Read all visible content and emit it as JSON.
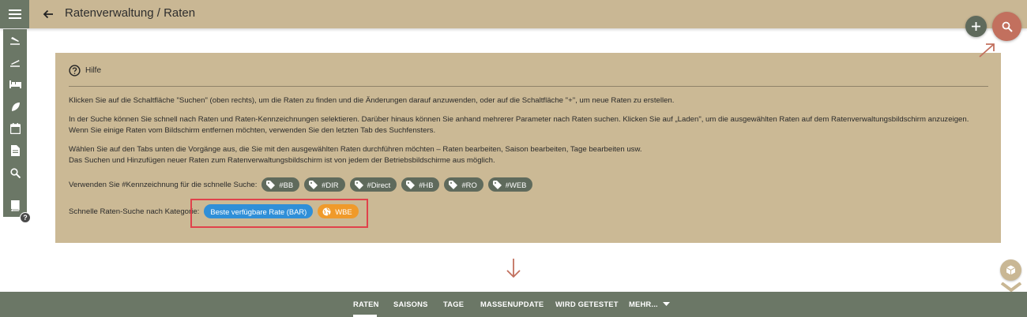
{
  "header": {
    "title": "Ratenverwaltung / Raten",
    "menu_icon": "menu-icon",
    "back_icon": "arrow-back-icon",
    "add_icon": "plus-icon",
    "search_icon": "search-icon"
  },
  "sidebar": {
    "items": [
      {
        "icon": "flight-land-icon"
      },
      {
        "icon": "flight-takeoff-icon"
      },
      {
        "icon": "bed-icon"
      },
      {
        "icon": "leaf-icon"
      },
      {
        "icon": "calendar-icon"
      },
      {
        "icon": "document-icon"
      },
      {
        "icon": "search-icon"
      },
      {
        "icon": "book-icon"
      }
    ],
    "help_badge": "?"
  },
  "panel": {
    "help_label": "Hilfe",
    "para1": "Klicken Sie auf die Schaltfläche \"Suchen\" (oben rechts), um die Raten zu finden und die Änderungen darauf anzuwenden, oder auf die Schaltfläche \"+\", um neue Raten zu erstellen.",
    "para2_line1": "In der Suche können Sie schnell nach Raten und Raten-Kennzeichnungen selektieren. Darüber hinaus können Sie anhand mehrerer Parameter nach Raten suchen. Klicken Sie auf „Laden\", um die ausgewählten Raten auf dem Ratenverwaltungsbildschirm anzuzeigen.",
    "para2_line2": "Wenn Sie einige Raten vom Bildschirm entfernen möchten, verwenden Sie den letzten Tab des Suchfensters.",
    "para3_line1": "Wählen Sie auf den Tabs unten die Vorgänge aus, die Sie mit den ausgewählten Raten durchführen möchten – Raten bearbeiten, Saison bearbeiten, Tage bearbeiten usw.",
    "para3_line2": "Das Suchen und Hinzufügen neuer Raten zum Ratenverwaltungsbildschirm ist von jedem der Betriebsbildschirme aus möglich.",
    "tags_label": "Verwenden Sie #Kennzeichnung für die schnelle Suche:",
    "tags": [
      "#BB",
      "#DIR",
      "#Direct",
      "#HB",
      "#RO",
      "#WEB"
    ],
    "category_label": "Schnelle Raten-Suche nach Kategorie:",
    "category_chip_bar": "Beste verfügbare Rate (BAR)",
    "category_chip_wbe": "WBE"
  },
  "tabs": [
    "RATEN",
    "SAISONS",
    "TAGE",
    "MASSENUPDATE",
    "WIRD GETESTET",
    "MEHR..."
  ],
  "active_tab": "RATEN",
  "colors": {
    "header": "#c9b794",
    "panel": "#cbb995",
    "sidebar": "#6b7766",
    "search_fab": "#c2705e",
    "chip_blue": "#2f8fd8",
    "chip_orange": "#f09a2a",
    "highlight": "#e0424b"
  }
}
